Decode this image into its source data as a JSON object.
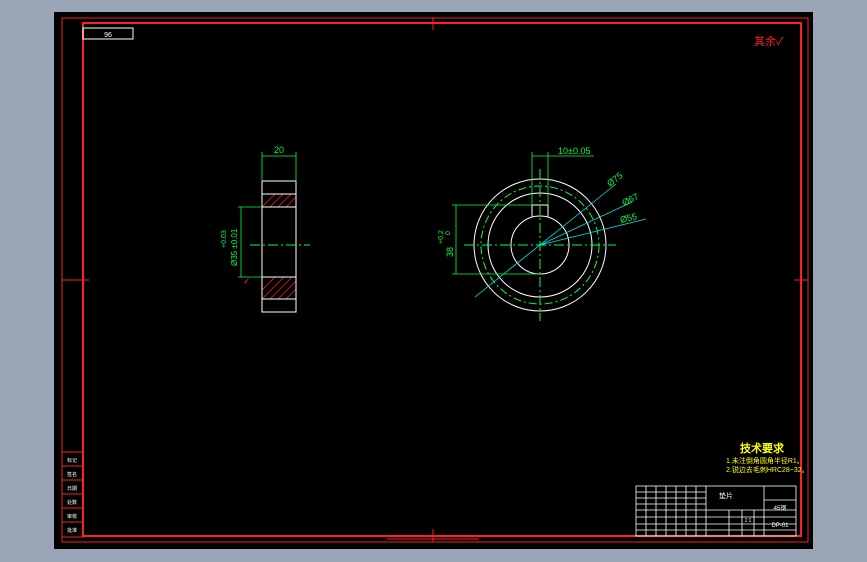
{
  "title_box": {
    "label": "96"
  },
  "corner_mark": "其余✓",
  "side_view": {
    "width_dim": "20",
    "dia_dim_main": "Ø35 ±0.01",
    "dia_dim_tol": "+0.03"
  },
  "front_view": {
    "keyway_dim": "10±0.05",
    "dia_outer": "Ø75",
    "dia_mid": "Ø67",
    "dia_inner": "Ø55",
    "height_dim": "38",
    "height_tol": "+0.2",
    "height_tol2": "0"
  },
  "tech_req": {
    "heading": "技术要求",
    "line1": "1.未注倒角圆角半径R1。",
    "line2": "2.锐边去毛刺HRC28~32。"
  },
  "title_block": {
    "name": "垫片",
    "material": "45钢",
    "drawing_no": "DP-01",
    "scale": "1:1"
  },
  "left_strip": {
    "items": [
      "标记",
      "签名",
      "日期",
      "处数",
      "审核",
      "批准"
    ]
  },
  "colors": {
    "frame": "#ff2020",
    "line": "#ffffff",
    "dimension": "#00ff40",
    "center": "#00ff40",
    "hatch": "#ff2020",
    "leader": "#00e0e0",
    "text_yellow": "#ffff00"
  }
}
